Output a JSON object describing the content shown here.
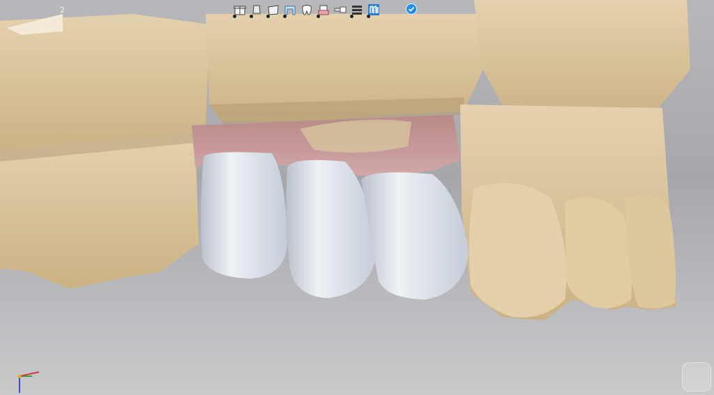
{
  "toolbar": {
    "tools": [
      {
        "id": "model",
        "icon": "gift-box-icon"
      },
      {
        "id": "prep",
        "icon": "abutment-icon"
      },
      {
        "id": "shell",
        "icon": "shell-icon"
      },
      {
        "id": "bridge",
        "icon": "bridge-icon"
      },
      {
        "id": "tooth",
        "icon": "tooth-icon"
      },
      {
        "id": "gingiva",
        "icon": "gingiva-icon"
      },
      {
        "id": "tool",
        "icon": "screw-icon"
      },
      {
        "id": "layers",
        "icon": "layers-icon"
      },
      {
        "id": "crowns",
        "icon": "crowns-icon"
      }
    ],
    "confirm_icon": "check-icon"
  },
  "overlay": {
    "corner_label": "2"
  },
  "colors": {
    "model": "#d9c4a0",
    "model_shadow": "#b59c72",
    "crown": "#dde3ea",
    "gingiva": "#c79a9a",
    "accent": "#1e8ee6"
  }
}
